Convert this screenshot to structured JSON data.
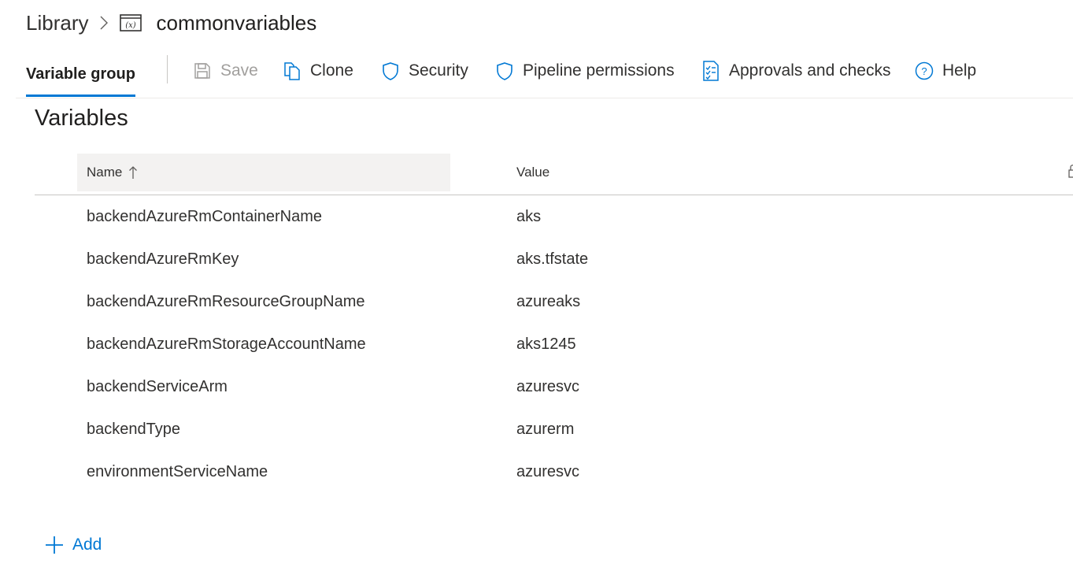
{
  "breadcrumb": {
    "library": "Library",
    "title": "commonvariables",
    "separator_icon": "chevron-right-icon",
    "title_icon": "variable-group-icon"
  },
  "toolbar": {
    "tab_label": "Variable group",
    "save_label": "Save",
    "clone_label": "Clone",
    "security_label": "Security",
    "pipeline_permissions_label": "Pipeline permissions",
    "approvals_label": "Approvals and checks",
    "help_label": "Help"
  },
  "variables": {
    "section_title": "Variables",
    "columns": {
      "name": "Name",
      "value": "Value"
    },
    "rows": [
      {
        "name": "backendAzureRmContainerName",
        "value": "aks"
      },
      {
        "name": "backendAzureRmKey",
        "value": "aks.tfstate"
      },
      {
        "name": "backendAzureRmResourceGroupName",
        "value": "azureaks"
      },
      {
        "name": "backendAzureRmStorageAccountName",
        "value": "aks1245"
      },
      {
        "name": "backendServiceArm",
        "value": "azuresvc"
      },
      {
        "name": "backendType",
        "value": "azurerm"
      },
      {
        "name": "environmentServiceName",
        "value": "azuresvc"
      }
    ],
    "add_label": "Add"
  },
  "colors": {
    "accent": "#0078d4",
    "text": "#323130",
    "disabled": "#a19f9d",
    "header_bg": "#f3f2f1"
  }
}
